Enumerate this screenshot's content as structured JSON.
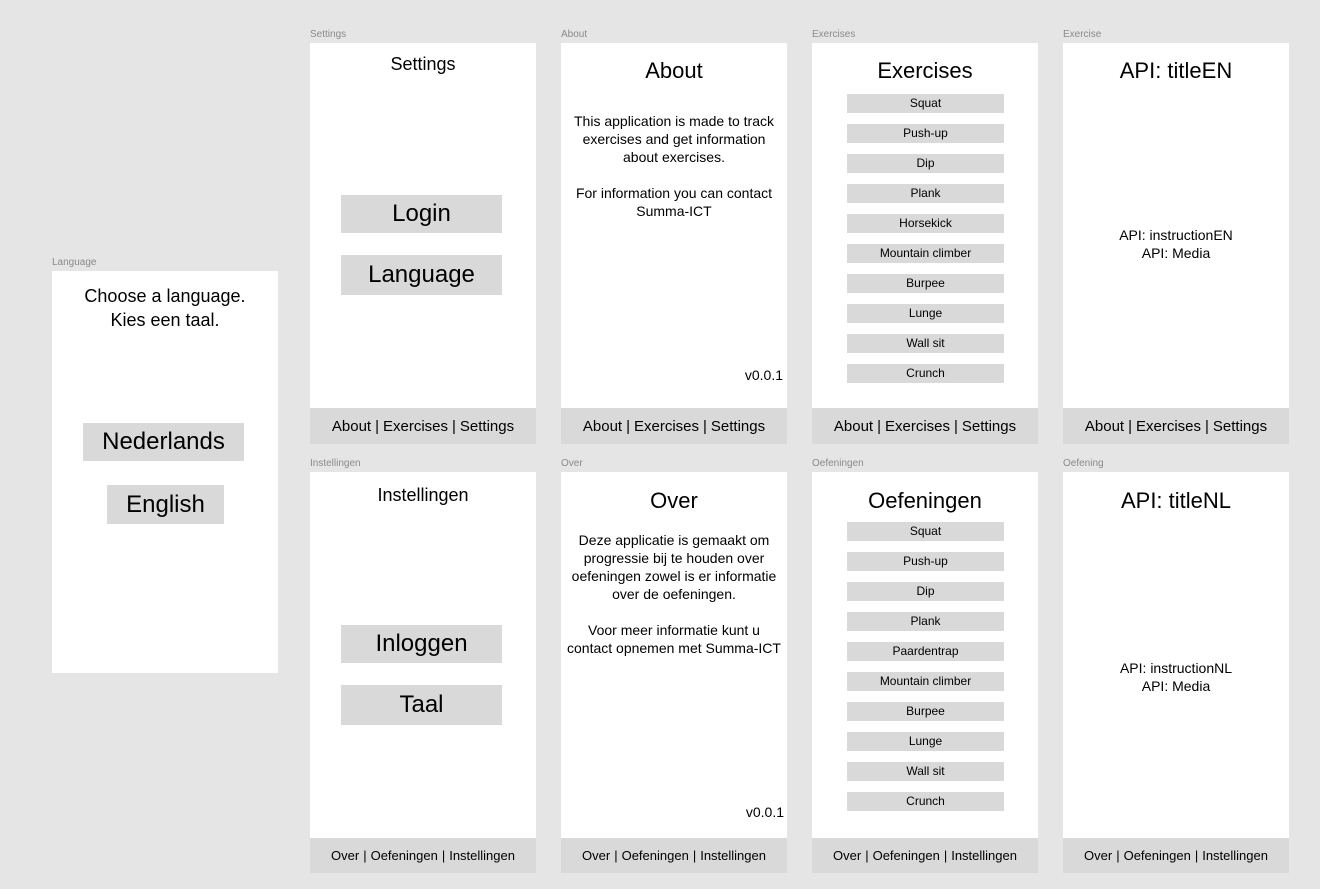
{
  "language": {
    "frame_label": "Language",
    "line1": "Choose a language.",
    "line2": "Kies een taal.",
    "btn_nl": "Nederlands",
    "btn_en": "English"
  },
  "settings": {
    "frame_label": "Settings",
    "title": "Settings",
    "btn_login": "Login",
    "btn_language": "Language"
  },
  "about": {
    "frame_label": "About",
    "title": "About",
    "paragraph1": "This application is made to track exercises and get information about exercises.",
    "paragraph2": "For information you can contact Summa-ICT",
    "version": "v0.0.1"
  },
  "exercises": {
    "frame_label": "Exercises",
    "title": "Exercises",
    "items": [
      "Squat",
      "Push-up",
      "Dip",
      "Plank",
      "Horsekick",
      "Mountain climber",
      "Burpee",
      "Lunge",
      "Wall sit",
      "Crunch"
    ]
  },
  "exercise": {
    "frame_label": "Exercise",
    "title": "API: titleEN",
    "instruction": "API: instructionEN",
    "media": "API: Media"
  },
  "nav_en": {
    "about": "About",
    "exercises": "Exercises",
    "settings": "Settings",
    "separator": "|"
  },
  "instellingen": {
    "frame_label": "Instellingen",
    "title": "Instellingen",
    "btn_login": "Inloggen",
    "btn_language": "Taal"
  },
  "over": {
    "frame_label": "Over",
    "title": "Over",
    "paragraph1": "Deze applicatie is gemaakt om progressie bij te houden over oefeningen zowel is er informatie over de oefeningen.",
    "paragraph2": "Voor meer informatie kunt u contact opnemen met Summa-ICT",
    "version": "v0.0.1"
  },
  "oefeningen": {
    "frame_label": "Oefeningen",
    "title": "Oefeningen",
    "items": [
      "Squat",
      "Push-up",
      "Dip",
      "Plank",
      "Paardentrap",
      "Mountain climber",
      "Burpee",
      "Lunge",
      "Wall sit",
      "Crunch"
    ]
  },
  "oefening": {
    "frame_label": "Oefening",
    "title": "API: titleNL",
    "instruction": "API: instructionNL",
    "media": "API: Media"
  },
  "nav_nl": {
    "over": "Over",
    "oefeningen": "Oefeningen",
    "instellingen": "Instellingen",
    "separator": "|"
  }
}
